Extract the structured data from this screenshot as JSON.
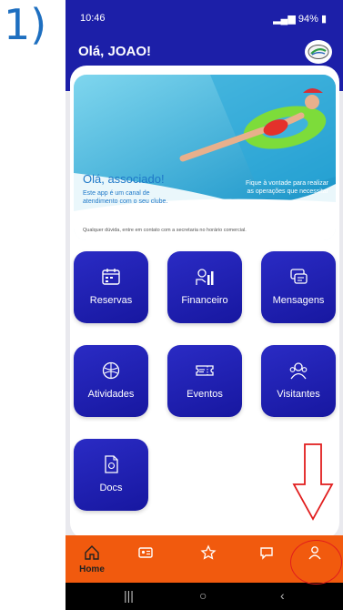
{
  "annotation": {
    "step_label": "1)"
  },
  "status_bar": {
    "time": "10:46",
    "right_text": "94%"
  },
  "header": {
    "greeting": "Olá, JOAO!",
    "logo_icon": "club-logo-icon"
  },
  "banner": {
    "title": "Olá, associado!",
    "subtitle": "Este app é um canal de atendimento com o seu clube.",
    "right_text": "Fique à vontade para realizar as operações que necessitar",
    "footer": "Qualquer dúvida, entre em contato com a secretaria no horário comercial."
  },
  "tiles": [
    {
      "label": "Reservas",
      "icon": "calendar-icon"
    },
    {
      "label": "Financeiro",
      "icon": "finance-icon"
    },
    {
      "label": "Mensagens",
      "icon": "messages-icon"
    },
    {
      "label": "Atividades",
      "icon": "activities-icon"
    },
    {
      "label": "Eventos",
      "icon": "ticket-icon"
    },
    {
      "label": "Visitantes",
      "icon": "visitors-icon"
    },
    {
      "label": "Docs",
      "icon": "document-icon"
    }
  ],
  "bottom_nav": {
    "home_label": "Home",
    "items": [
      "home-icon",
      "member-card-icon",
      "star-icon",
      "chat-icon",
      "profile-icon"
    ]
  },
  "colors": {
    "primary": "#1c1fa8",
    "accent": "#f15a0e",
    "annotation": "#e11d1d"
  }
}
